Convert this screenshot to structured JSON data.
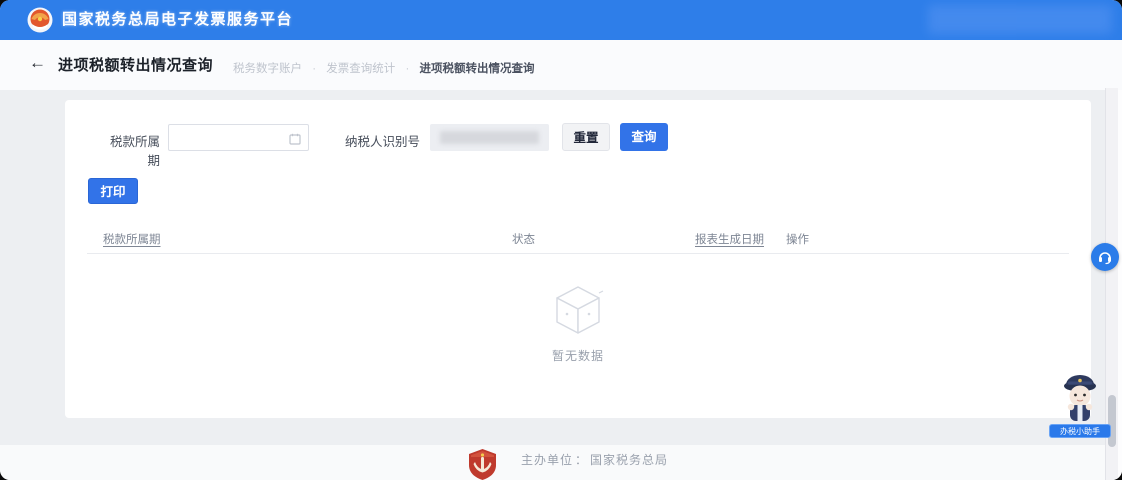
{
  "header": {
    "app_title": "国家税务总局电子发票服务平台"
  },
  "breadcrumb": {
    "back_icon": "←",
    "page_title": "进项税额转出情况查询",
    "separator": "·",
    "items": [
      "税务数字账户",
      "发票查询统计",
      "进项税额转出情况查询"
    ]
  },
  "query_form": {
    "period_label": "税款所属期",
    "period_value": "",
    "taxpayer_label": "纳税人识别号",
    "taxpayer_value": "",
    "reset_button": "重置",
    "query_button": "查询"
  },
  "toolbar": {
    "print_button": "打印"
  },
  "table": {
    "columns": [
      "税款所属期",
      "状态",
      "报表生成日期",
      "操作"
    ],
    "empty_text": "暂无数据"
  },
  "footer": {
    "host_label": "主办单位",
    "separator": "：",
    "host_value": "国家税务总局"
  },
  "assistant": {
    "badge_text": "办税小助手"
  },
  "colors": {
    "header_bg": "#2E7EE9",
    "accent": "#3273E8",
    "empty_icon": "#D5D9E1"
  }
}
